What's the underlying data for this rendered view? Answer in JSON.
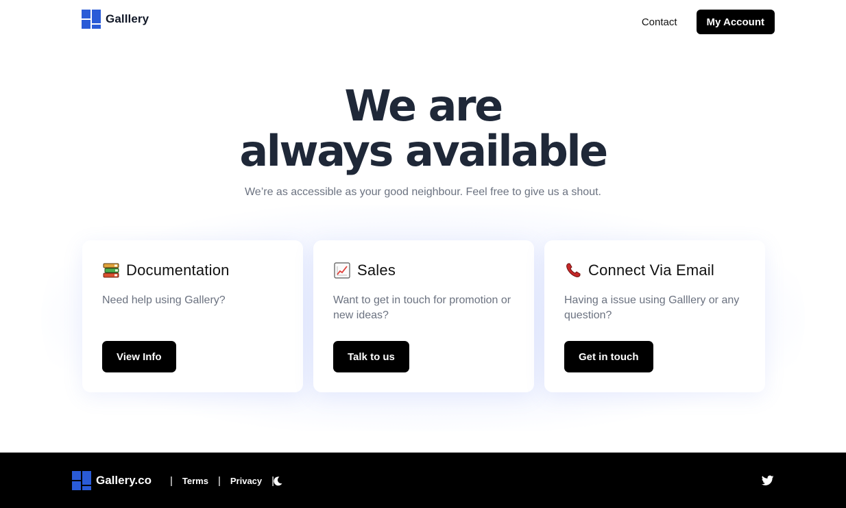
{
  "header": {
    "brand": "Galllery",
    "nav_contact": "Contact",
    "nav_account": "My Account"
  },
  "hero": {
    "title_line1": "We are",
    "title_line2": "always available",
    "subtitle": "We’re as accessible as your good neighbour. Feel free to give us a shout."
  },
  "cards": [
    {
      "icon": "books-icon",
      "title": "Documentation",
      "description": "Need help using Gallery?",
      "button": "View Info"
    },
    {
      "icon": "chart-increasing-icon",
      "title": "Sales",
      "description": "Want to get in touch for promotion or new ideas?",
      "button": "Talk to us"
    },
    {
      "icon": "phone-receiver-icon",
      "title": "Connect Via Email",
      "description": "Having a issue using Galllery or any question?",
      "button": "Get in touch"
    }
  ],
  "footer": {
    "brand": "Gallery.co",
    "terms": "Terms",
    "privacy": "Privacy",
    "theme_icon": "moon-icon",
    "social_icon": "twitter-icon"
  },
  "colors": {
    "logo_blue": "#2a5bd7",
    "heading": "#1f2838",
    "button_bg": "#000000"
  }
}
